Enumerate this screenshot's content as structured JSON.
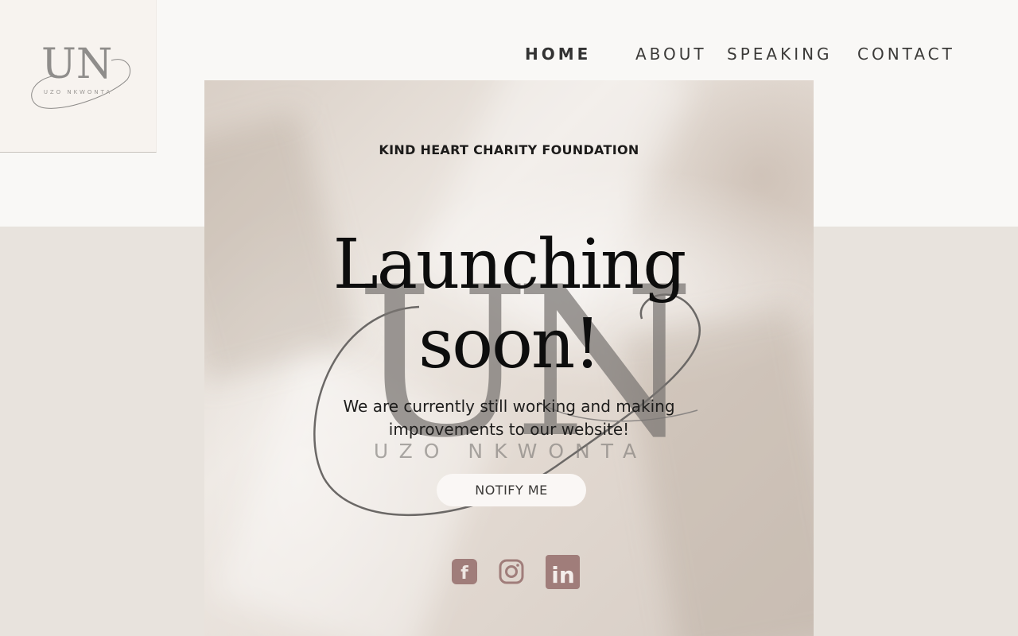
{
  "nav": {
    "items": [
      {
        "label": "HOME",
        "active": true
      },
      {
        "label": "ABOUT",
        "active": false
      },
      {
        "label": "SPEAKING",
        "active": false
      },
      {
        "label": "CONTACT",
        "active": false
      }
    ]
  },
  "logo": {
    "monogram": "UN",
    "name": "UZO NKWONTA"
  },
  "hero": {
    "organization": "KIND HEART CHARITY FOUNDATION",
    "headline_line1": "Launching",
    "headline_line2": "soon!",
    "subtext_line1": "We are currently still working and making",
    "subtext_line2": "improvements to our website!",
    "watermark_monogram": "UN",
    "watermark_name": "UZO NKWONTA",
    "notify_button": "NOTIFY ME"
  },
  "social": [
    {
      "icon": "facebook-icon",
      "glyph": "f"
    },
    {
      "icon": "instagram-icon"
    },
    {
      "icon": "linkedin-icon",
      "glyph": "in"
    }
  ],
  "colors": {
    "page_bg": "#e8e3dd",
    "top_band": "#f9f8f6",
    "social_icon": "#a07d7a",
    "text_dark": "#0d0d0d"
  }
}
